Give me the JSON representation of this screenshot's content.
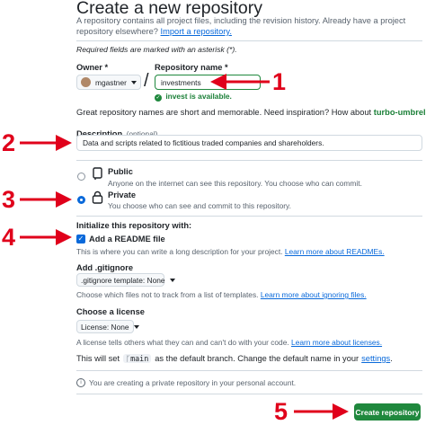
{
  "header": {
    "title": "Create a new repository",
    "subtitle": "A repository contains all project files, including the revision history. Already have a project repository elsewhere?",
    "import_link": "Import a repository."
  },
  "required_note": "Required fields are marked with an asterisk (*).",
  "owner": {
    "label": "Owner *",
    "value": "mgastner"
  },
  "repo_name": {
    "label": "Repository name *",
    "value": "investments",
    "availability": "invest is available.",
    "separator": "/"
  },
  "suggestion": {
    "text": "Great repository names are short and memorable. Need inspiration? How about",
    "name": "turbo-umbrella",
    "suffix": "?"
  },
  "description": {
    "label": "Description",
    "optional": "(optional)",
    "value": "Data and scripts related to fictitious traded companies and shareholders."
  },
  "visibility": {
    "public": {
      "label": "Public",
      "desc": "Anyone on the internet can see this repository. You choose who can commit."
    },
    "private": {
      "label": "Private",
      "desc": "You choose who can see and commit to this repository.",
      "selected": true
    }
  },
  "init": {
    "heading": "Initialize this repository with:",
    "readme_label": "Add a README file",
    "readme_checked": true,
    "readme_desc": "This is where you can write a long description for your project.",
    "readme_link": "Learn more about READMEs."
  },
  "gitignore": {
    "heading": "Add .gitignore",
    "select": ".gitignore template: None",
    "desc": "Choose which files not to track from a list of templates.",
    "link": "Learn more about ignoring files."
  },
  "license": {
    "heading": "Choose a license",
    "select": "License: None",
    "desc": "A license tells others what they can and can't do with your code.",
    "link": "Learn more about licenses."
  },
  "branch_note": {
    "prefix": "This will set",
    "branch": "main",
    "middle": "as the default branch. Change the default name in your",
    "link": "settings",
    "suffix": "."
  },
  "private_notice": "You are creating a private repository in your personal account.",
  "create_button": "Create repository",
  "annotations": [
    "1",
    "2",
    "3",
    "4",
    "5"
  ],
  "colors": {
    "accent_blue": "#0969da",
    "success_green": "#1f883d",
    "annotation_red": "#e0001b"
  }
}
